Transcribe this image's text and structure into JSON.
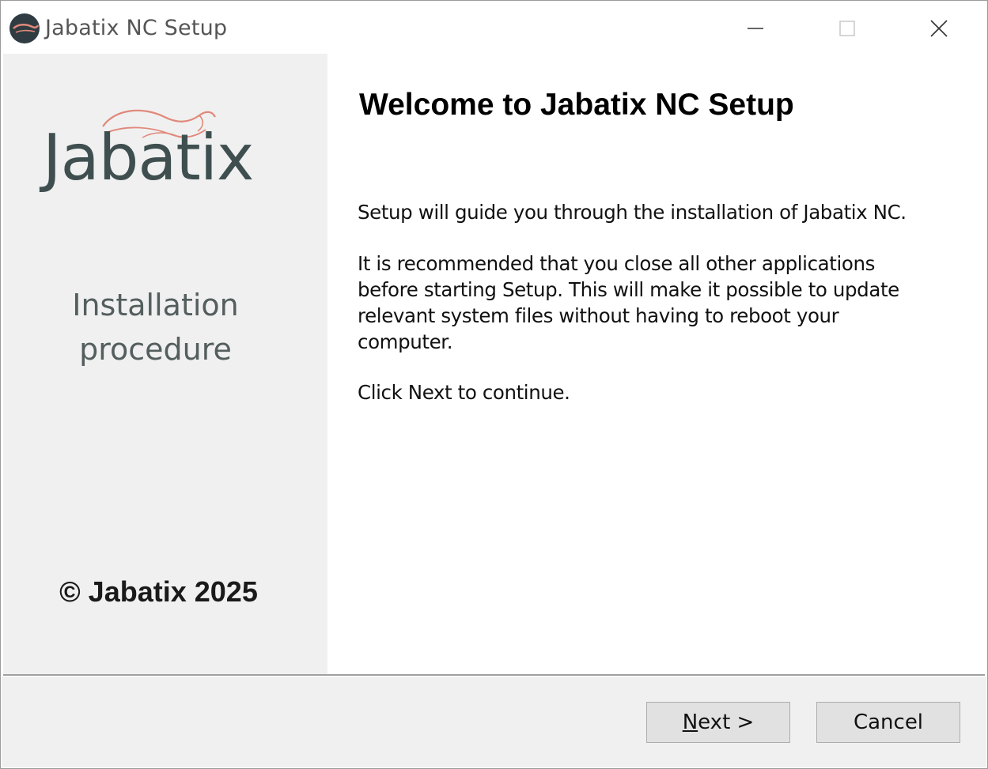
{
  "window": {
    "title": "Jabatix NC Setup",
    "controls": {
      "minimize": "minimize",
      "maximize": "maximize",
      "close": "close"
    }
  },
  "banner": {
    "logo_text": "Jabatix",
    "procedure_line1": "Installation",
    "procedure_line2": "procedure",
    "copyright": "© Jabatix 2025"
  },
  "content": {
    "heading": "Welcome to Jabatix NC Setup",
    "paragraph1": "Setup will guide you through the installation of Jabatix NC.",
    "paragraph2": "It is recommended that you close all other applications before starting Setup. This will make it possible to update relevant system files without having to reboot your computer.",
    "paragraph3": "Click Next to continue."
  },
  "buttons": {
    "next_mnemonic": "N",
    "next_rest": "ext >",
    "cancel": "Cancel"
  },
  "colors": {
    "banner_bg": "#f0f0f0",
    "logo_text": "#3f4f4f",
    "logo_swoosh": "#e0897a",
    "footer_bg": "#f0f0f0",
    "button_bg": "#e1e1e1"
  },
  "icons": {
    "app": "jabatix-app-icon",
    "minimize": "minimize-icon",
    "maximize": "maximize-icon",
    "close": "close-icon",
    "logo": "squirrel-swoosh-icon"
  }
}
